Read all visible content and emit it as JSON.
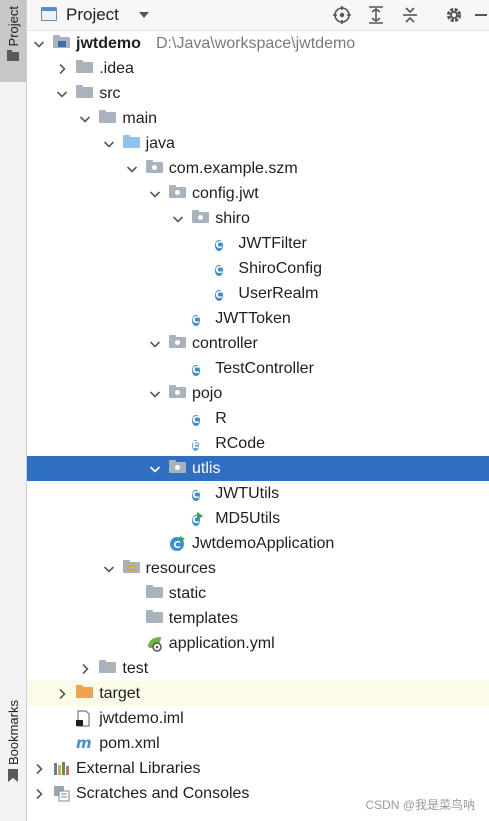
{
  "side_strip": {
    "project_label": "Project",
    "bookmarks_label": "Bookmarks"
  },
  "header": {
    "title": "Project",
    "actions": [
      "locate-icon",
      "expand-all-icon",
      "collapse-all-icon",
      "settings-icon"
    ]
  },
  "tree": [
    {
      "label": "jwtdemo",
      "path": "D:\\Java\\workspace\\jwtdemo",
      "depth": 0,
      "arrow": "down",
      "icon": "project-module"
    },
    {
      "label": ".idea",
      "depth": 1,
      "arrow": "right",
      "icon": "folder-gray"
    },
    {
      "label": "src",
      "depth": 1,
      "arrow": "down",
      "icon": "folder-gray"
    },
    {
      "label": "main",
      "depth": 2,
      "arrow": "down",
      "icon": "folder-gray"
    },
    {
      "label": "java",
      "depth": 3,
      "arrow": "down",
      "icon": "folder-blue"
    },
    {
      "label": "com.example.szm",
      "depth": 4,
      "arrow": "down",
      "icon": "package"
    },
    {
      "label": "config.jwt",
      "depth": 5,
      "arrow": "down",
      "icon": "package"
    },
    {
      "label": "shiro",
      "depth": 6,
      "arrow": "down",
      "icon": "package"
    },
    {
      "label": "JWTFilter",
      "depth": 7,
      "arrow": "none",
      "icon": "class"
    },
    {
      "label": "ShiroConfig",
      "depth": 7,
      "arrow": "none",
      "icon": "class"
    },
    {
      "label": "UserRealm",
      "depth": 7,
      "arrow": "none",
      "icon": "class"
    },
    {
      "label": "JWTToken",
      "depth": 6,
      "arrow": "none",
      "icon": "class"
    },
    {
      "label": "controller",
      "depth": 5,
      "arrow": "down",
      "icon": "package"
    },
    {
      "label": "TestController",
      "depth": 6,
      "arrow": "none",
      "icon": "class"
    },
    {
      "label": "pojo",
      "depth": 5,
      "arrow": "down",
      "icon": "package"
    },
    {
      "label": "R",
      "depth": 6,
      "arrow": "none",
      "icon": "class"
    },
    {
      "label": "RCode",
      "depth": 6,
      "arrow": "none",
      "icon": "enum"
    },
    {
      "label": "utlis",
      "depth": 5,
      "arrow": "down",
      "icon": "package",
      "selected": true
    },
    {
      "label": "JWTUtils",
      "depth": 6,
      "arrow": "none",
      "icon": "class"
    },
    {
      "label": "MD5Utils",
      "depth": 6,
      "arrow": "none",
      "icon": "class-run"
    },
    {
      "label": "JwtdemoApplication",
      "depth": 5,
      "arrow": "none",
      "icon": "spring-app"
    },
    {
      "label": "resources",
      "depth": 3,
      "arrow": "down",
      "icon": "folder-resources"
    },
    {
      "label": "static",
      "depth": 4,
      "arrow": "none",
      "icon": "folder-gray"
    },
    {
      "label": "templates",
      "depth": 4,
      "arrow": "none",
      "icon": "folder-gray"
    },
    {
      "label": "application.yml",
      "depth": 4,
      "arrow": "none",
      "icon": "yml"
    },
    {
      "label": "test",
      "depth": 2,
      "arrow": "right",
      "icon": "folder-gray"
    },
    {
      "label": "target",
      "depth": 1,
      "arrow": "right",
      "icon": "folder-orange",
      "excluded": true
    },
    {
      "label": "jwtdemo.iml",
      "depth": 1,
      "arrow": "none",
      "icon": "iml"
    },
    {
      "label": "pom.xml",
      "depth": 1,
      "arrow": "none",
      "icon": "maven"
    },
    {
      "label": "External Libraries",
      "depth": 0,
      "arrow": "right",
      "icon": "libraries"
    },
    {
      "label": "Scratches and Consoles",
      "depth": 0,
      "arrow": "right",
      "icon": "scratches"
    }
  ],
  "watermark": "CSDN @我是菜鸟呐",
  "colors": {
    "selection": "#2f6fc2",
    "excluded_row": "#fcfbe7",
    "folder_gray": "#a9b3bd",
    "folder_blue": "#8ec4ec",
    "folder_orange": "#f0a34e",
    "class_icon": "#3d8fd1"
  }
}
